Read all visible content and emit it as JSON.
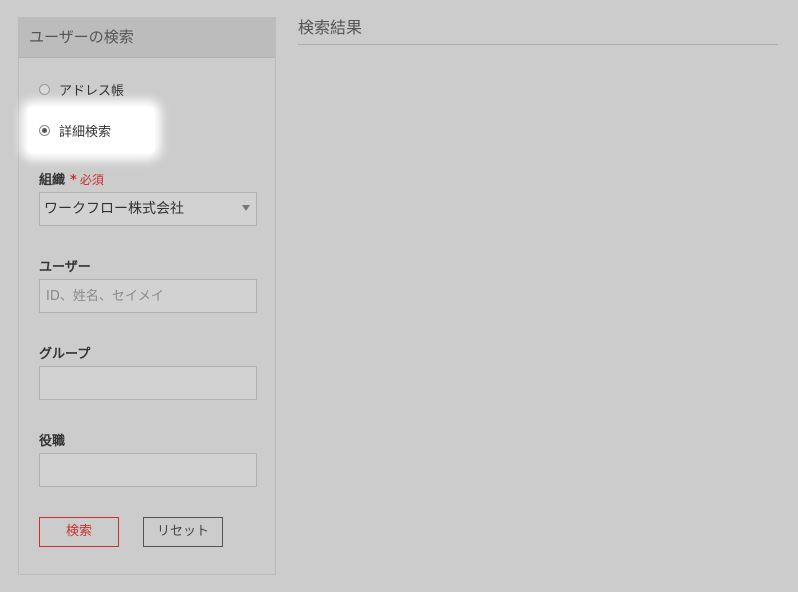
{
  "search_panel": {
    "title": "ユーザーの検索",
    "modes": [
      {
        "label": "アドレス帳",
        "selected": false
      },
      {
        "label": "詳細検索",
        "selected": true
      }
    ],
    "fields": {
      "organization": {
        "label": "組織",
        "required_mark": "*",
        "required_text": "必須",
        "value": "ワークフロー株式会社"
      },
      "user": {
        "label": "ユーザー",
        "placeholder": "ID、姓名、セイメイ",
        "value": ""
      },
      "group": {
        "label": "グループ",
        "value": ""
      },
      "position": {
        "label": "役職",
        "value": ""
      }
    },
    "buttons": {
      "search": "検索",
      "reset": "リセット"
    }
  },
  "results": {
    "title": "検索結果"
  },
  "colors": {
    "required": "#c9302c",
    "background": "#cccccc",
    "header": "#bcbcbc"
  }
}
